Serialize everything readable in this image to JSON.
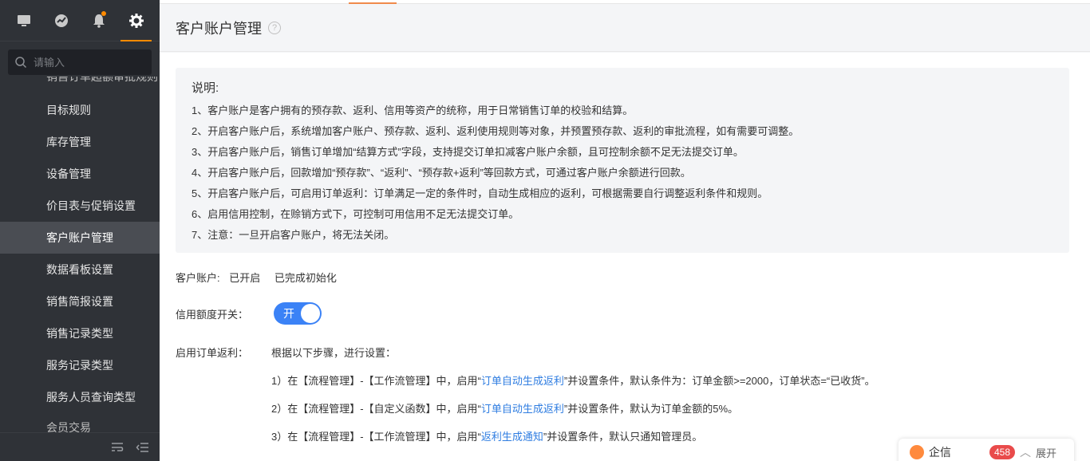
{
  "sidebar": {
    "search_placeholder": "请输入",
    "tabs": [
      "monitor-icon",
      "dashboard-icon",
      "bell-icon",
      "gear-icon"
    ],
    "menu": [
      {
        "label": "销售订单超额审批规则",
        "partial": true
      },
      {
        "label": "目标规则"
      },
      {
        "label": "库存管理"
      },
      {
        "label": "设备管理"
      },
      {
        "label": "价目表与促销设置"
      },
      {
        "label": "客户账户管理",
        "active": true
      },
      {
        "label": "数据看板设置"
      },
      {
        "label": "销售简报设置"
      },
      {
        "label": "销售记录类型"
      },
      {
        "label": "服务记录类型"
      },
      {
        "label": "服务人员查询类型"
      },
      {
        "label": "会员交易",
        "partial": true
      }
    ]
  },
  "header": {
    "title": "客户账户管理",
    "help": "?"
  },
  "description": {
    "heading": "说明:",
    "lines": [
      "1、客户账户是客户拥有的预存款、返利、信用等资产的统称，用于日常销售订单的校验和结算。",
      "2、开启客户账户后，系统增加客户账户、预存款、返利、返利使用规则等对象，并预置预存款、返利的审批流程，如有需要可调整。",
      "3、开启客户账户后，销售订单增加“结算方式”字段，支持提交订单扣减客户账户余额，且可控制余额不足无法提交订单。",
      "4、开启客户账户后，回款增加“预存款”、“返利”、“预存款+返利”等回款方式，可通过客户账户余额进行回款。",
      "5、开启客户账户后，可启用订单返利：订单满足一定的条件时，自动生成相应的返利，可根据需要自行调整返利条件和规则。",
      "6、启用信用控制，在赊销方式下，可控制可用信用不足无法提交订单。",
      "7、注意：一旦开启客户账户，将无法关闭。"
    ]
  },
  "account": {
    "label": "客户账户:",
    "status": "已开启",
    "init_status": "已完成初始化"
  },
  "credit": {
    "label": "信用额度开关：",
    "toggle_text": "开",
    "on": true
  },
  "rebate": {
    "label": "启用订单返利：",
    "lead": "根据以下步骤，进行设置：",
    "steps": [
      {
        "prefix": "1）在【流程管理】-【工作流管理】中，启用“",
        "link": "订单自动生成返利",
        "suffix": "”并设置条件，默认条件为：订单金额>=2000，订单状态=“已收货”。"
      },
      {
        "prefix": "2）在【流程管理】-【自定义函数】中，启用“",
        "link": "订单自动生成返利",
        "suffix": "”并设置条件，默认为订单金额的5%。"
      },
      {
        "prefix": "3）在【流程管理】-【工作流管理】中，启用“",
        "link": "返利生成通知",
        "suffix": "”并设置条件，默认只通知管理员。"
      }
    ]
  },
  "chat": {
    "title": "企信",
    "badge": "458",
    "expand": "展开"
  },
  "colors": {
    "sidebar_bg": "#2f3237",
    "accent": "#ff8a00",
    "link": "#2f7de1",
    "toggle": "#3b82f6"
  }
}
